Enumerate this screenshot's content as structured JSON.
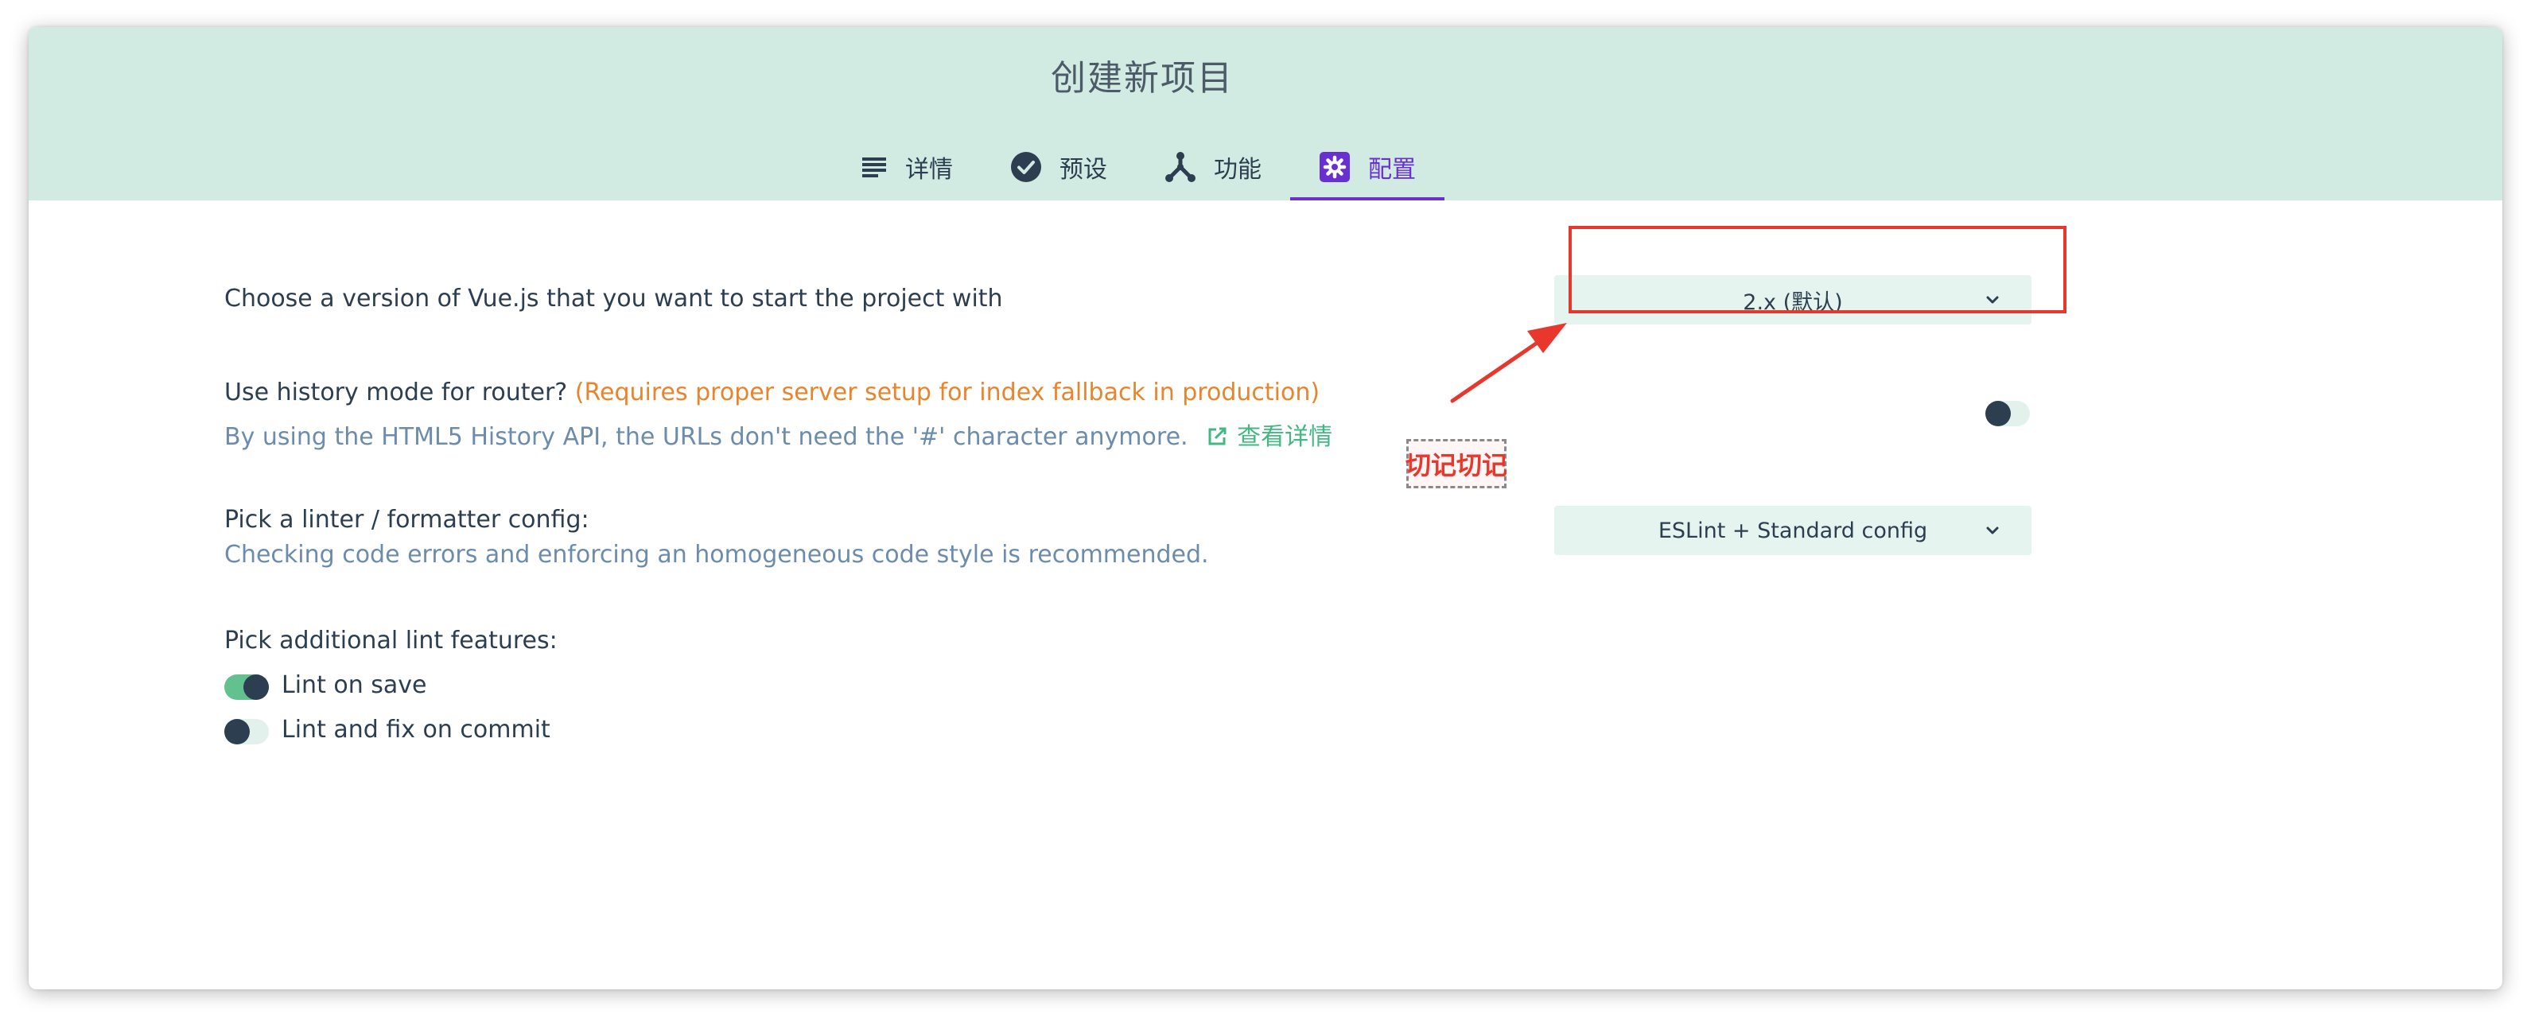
{
  "header": {
    "title": "创建新项目",
    "tabs": [
      {
        "label": "详情",
        "icon": "list-icon",
        "active": false
      },
      {
        "label": "预设",
        "icon": "check-circle-icon",
        "active": false
      },
      {
        "label": "功能",
        "icon": "fork-icon",
        "active": false
      },
      {
        "label": "配置",
        "icon": "settings-icon",
        "active": true
      }
    ]
  },
  "config": {
    "vue_version": {
      "label": "Choose a version of Vue.js that you want to start the project with",
      "selected": "2.x (默认)"
    },
    "history_mode": {
      "label": "Use history mode for router?",
      "warning": "(Requires proper server setup for index fallback in production)",
      "description": "By using the HTML5 History API, the URLs don't need the '#' character anymore.",
      "link_text": "查看详情",
      "enabled": false
    },
    "linter": {
      "label": "Pick a linter / formatter config:",
      "description": "Checking code errors and enforcing an homogeneous code style is recommended.",
      "selected": "ESLint + Standard config"
    },
    "lint_features": {
      "label": "Pick additional lint features:",
      "options": [
        {
          "label": "Lint on save",
          "enabled": true
        },
        {
          "label": "Lint and fix on commit",
          "enabled": false
        }
      ]
    }
  },
  "annotation": {
    "note": "切记切记"
  },
  "colors": {
    "header_bg": "#d1ebe2",
    "accent_purple": "#6a2fd1",
    "accent_green": "#42b983",
    "warning_orange": "#e8852c",
    "annotation_red": "#e8372c"
  }
}
